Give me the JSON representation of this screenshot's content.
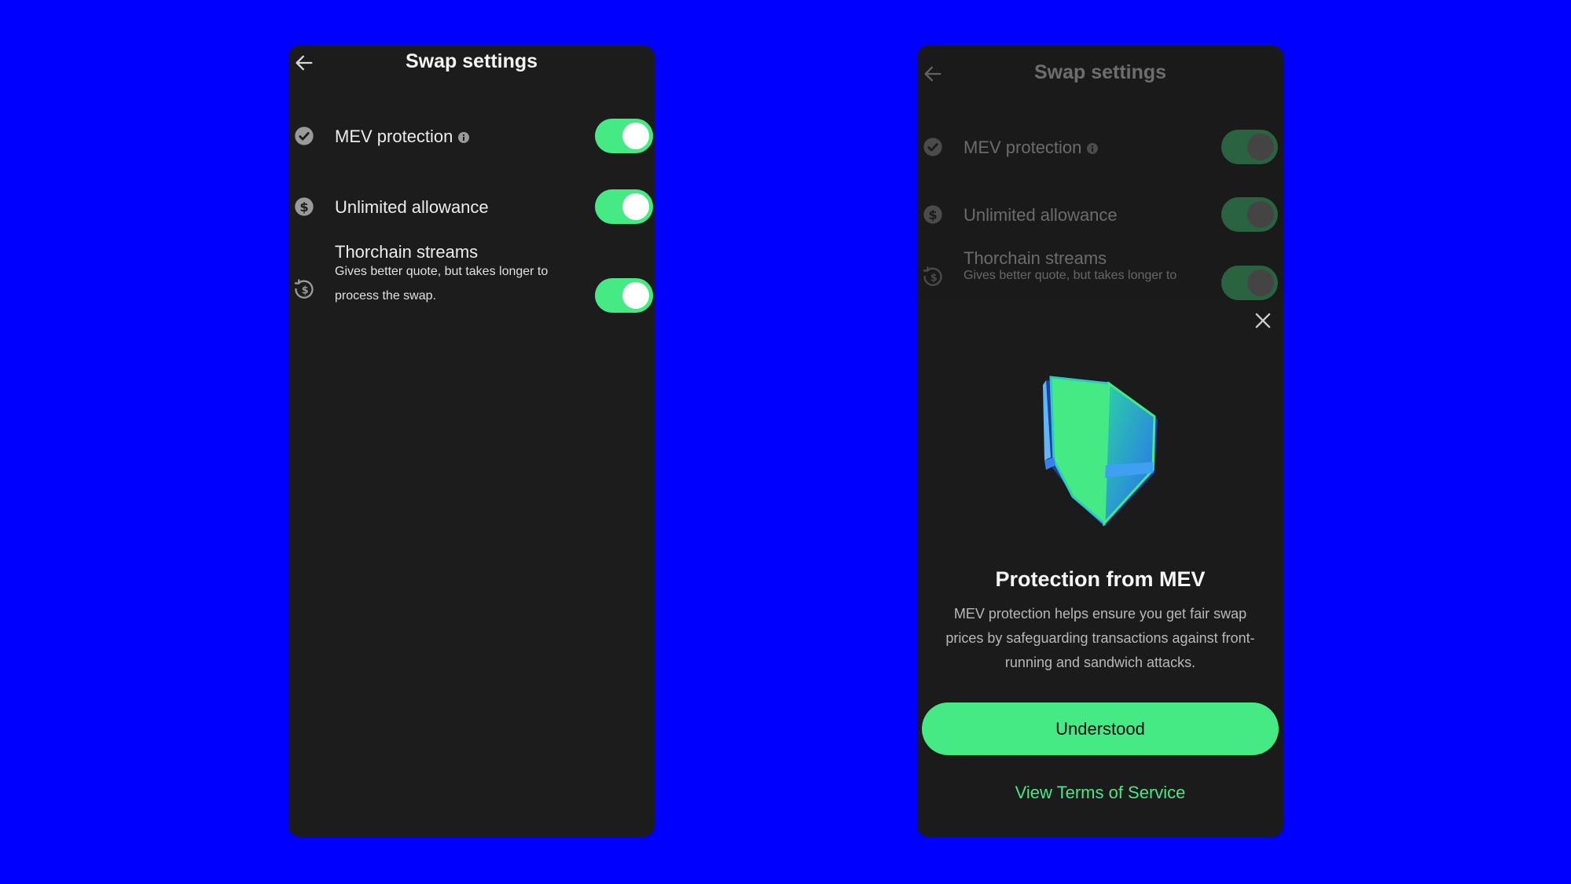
{
  "left_screen": {
    "title": "Swap settings",
    "settings": [
      {
        "label": "MEV protection",
        "icon": "shield-check-icon",
        "enabled": true
      },
      {
        "label": "Unlimited allowance",
        "icon": "dollar-circle-icon",
        "enabled": true
      },
      {
        "label": "Thorchain streams",
        "description": "Gives better quote, but takes longer to process the swap.",
        "icon": "history-dollar-icon",
        "enabled": true
      }
    ]
  },
  "right_screen": {
    "title": "Swap settings",
    "settings": [
      {
        "label": "MEV protection",
        "enabled": true
      },
      {
        "label": "Unlimited allowance",
        "enabled": true
      },
      {
        "label": "Thorchain streams",
        "description": "Gives better quote, but takes longer to",
        "enabled": true
      }
    ],
    "sheet": {
      "title": "Protection from MEV",
      "body": "MEV protection helps ensure you get fair swap prices by safeguarding transactions against front-running and sandwich attacks.",
      "primary_button": "Understood",
      "link": "View Terms of Service"
    }
  },
  "colors": {
    "background": "#0000fe",
    "panel": "#1c1c1c",
    "accent": "#45ea85"
  }
}
